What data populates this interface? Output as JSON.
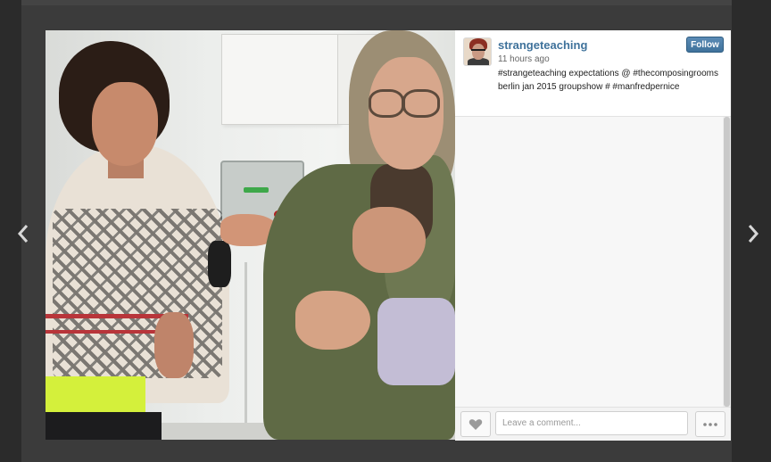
{
  "navigation": {
    "prev_icon": "chevron-left-icon",
    "next_icon": "chevron-right-icon"
  },
  "post": {
    "username": "strangeteaching",
    "timestamp": "11 hours ago",
    "caption": "#strangeteaching expectations @ #thecomposingrooms berlin jan 2015 groupshow # #manfredpernice",
    "follow_label": "Follow"
  },
  "actions": {
    "like_icon": "heart-icon",
    "comment_placeholder": "Leave a comment...",
    "more_icon": "more-options-icon"
  },
  "colors": {
    "username": "#3f729b",
    "follow_button": "#3f729b",
    "backdrop": "#2b2b2b"
  }
}
